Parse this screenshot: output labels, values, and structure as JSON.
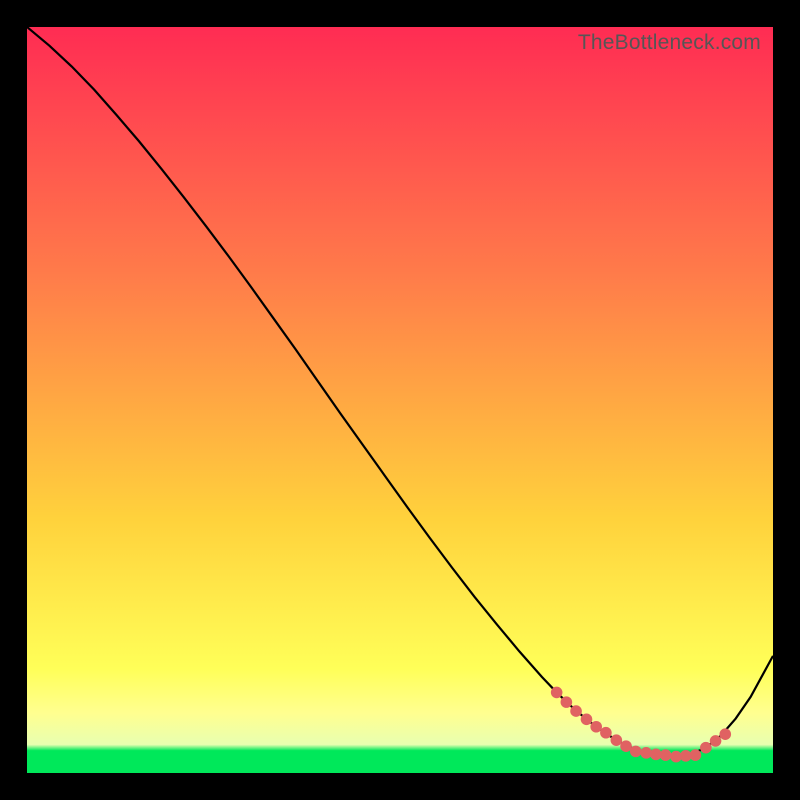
{
  "attribution": "TheBottleneck.com",
  "colors": {
    "top_gradient": "#ff2c53",
    "mid1_gradient": "#ff7b4a",
    "mid2_gradient": "#ffd23c",
    "yellow_band": "#ffff58",
    "green_band": "#00e85a",
    "curve": "#000000",
    "marker": "#e06262",
    "background": "#000000",
    "attribution": "#565656"
  },
  "chart_data": {
    "type": "line",
    "title": "",
    "xlabel": "",
    "ylabel": "",
    "xlim": [
      0,
      100
    ],
    "ylim": [
      0,
      100
    ],
    "curve": {
      "x": [
        0,
        3,
        6,
        9,
        12,
        15,
        18,
        21,
        24,
        27,
        30,
        33,
        36,
        39,
        42,
        45,
        48,
        51,
        54,
        57,
        60,
        63,
        66,
        69,
        71,
        73,
        75,
        77,
        79,
        81,
        83,
        85,
        87,
        89,
        91,
        93,
        95,
        97,
        100
      ],
      "y": [
        100,
        97.5,
        94.7,
        91.6,
        88.2,
        84.7,
        81.0,
        77.2,
        73.3,
        69.3,
        65.2,
        61.0,
        56.8,
        52.5,
        48.2,
        44.0,
        39.8,
        35.6,
        31.5,
        27.5,
        23.6,
        19.9,
        16.3,
        12.9,
        10.8,
        8.9,
        7.2,
        5.7,
        4.4,
        3.4,
        2.7,
        2.3,
        2.2,
        2.5,
        3.4,
        5.0,
        7.3,
        10.2,
        15.7
      ]
    },
    "markers": {
      "x": [
        71,
        72.3,
        73.6,
        75,
        76.3,
        77.6,
        79,
        80.3,
        81.6,
        83,
        84.3,
        85.6,
        87,
        88.3,
        89.6,
        91,
        92.3,
        93.6
      ],
      "y": [
        10.8,
        9.5,
        8.3,
        7.2,
        6.2,
        5.4,
        4.4,
        3.6,
        2.9,
        2.7,
        2.5,
        2.4,
        2.2,
        2.3,
        2.4,
        3.4,
        4.3,
        5.2
      ]
    }
  }
}
